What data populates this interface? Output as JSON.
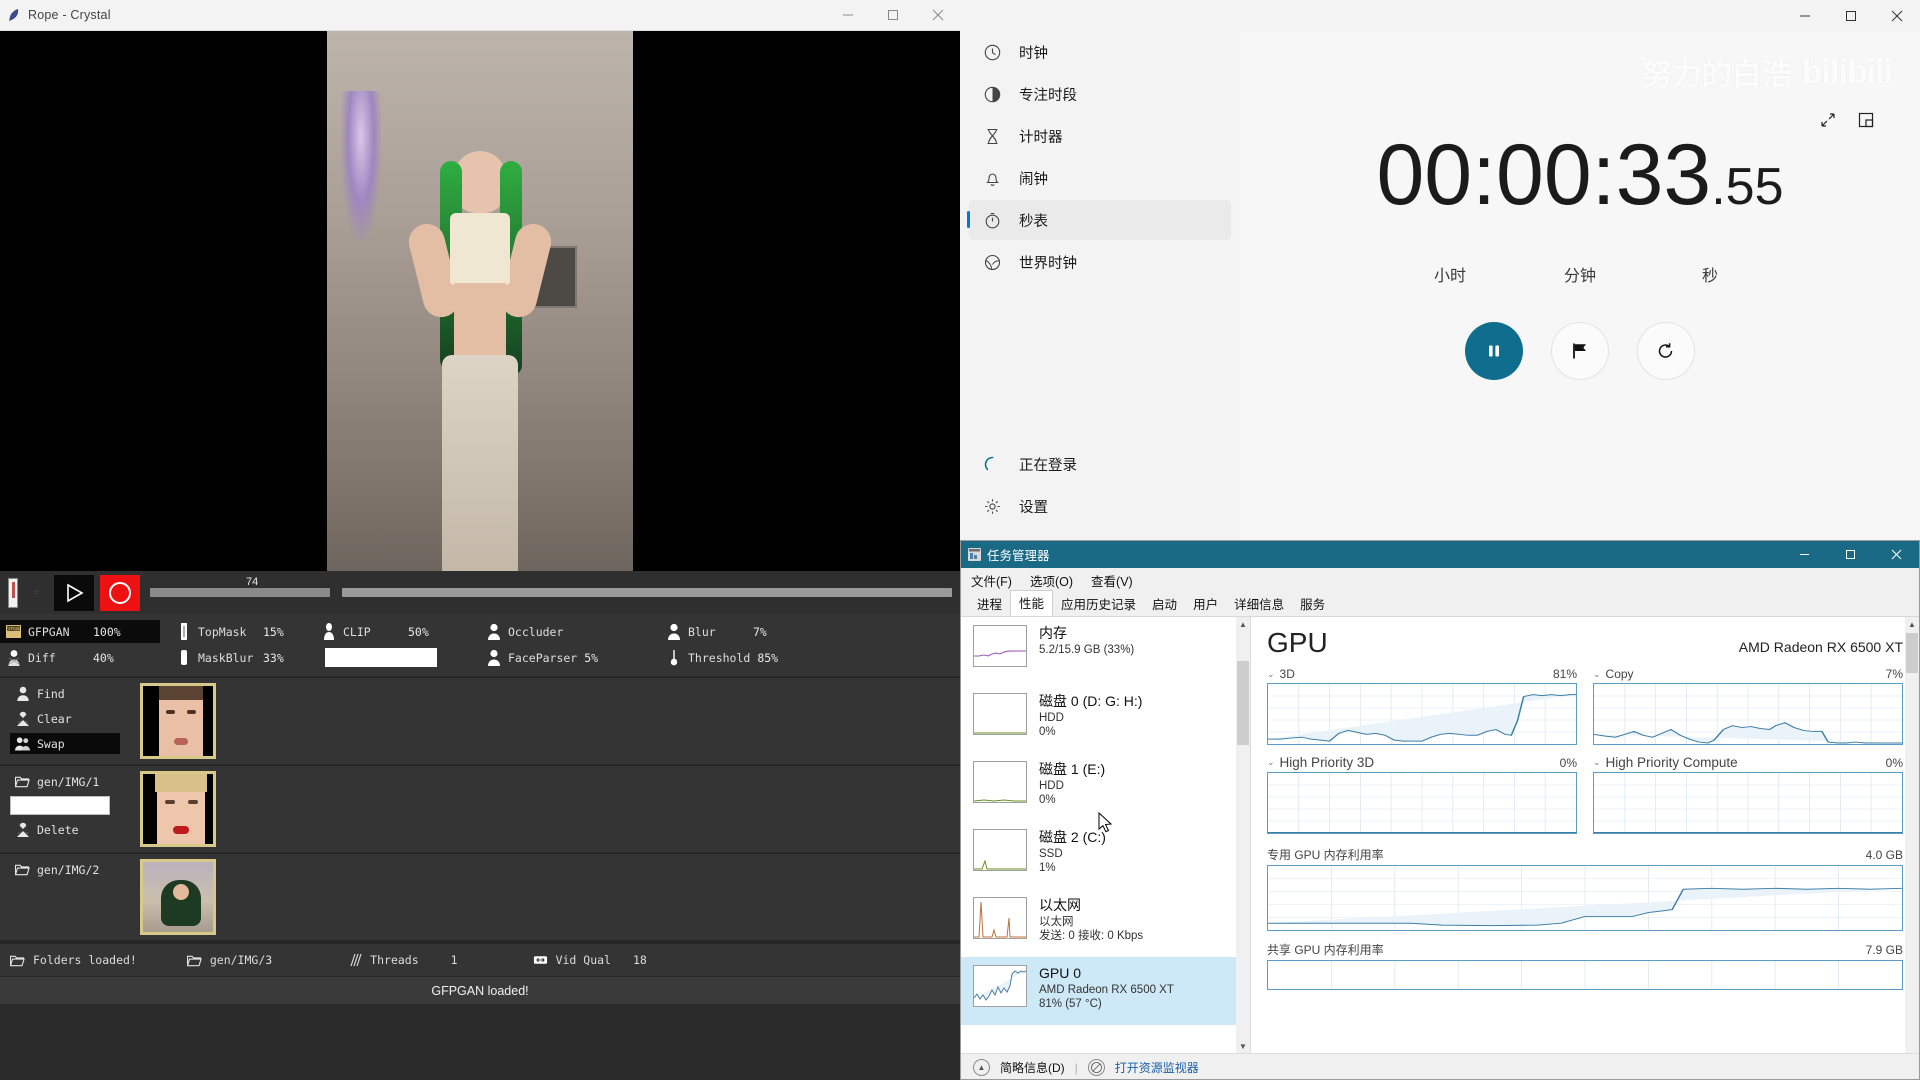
{
  "rope": {
    "titlebar": {
      "icon": "feather-icon",
      "title": "Rope - Crystal",
      "minimize": "—",
      "maximize": "□",
      "close": "✕"
    },
    "transport": {
      "play_label": "play-triangle",
      "record_label": "record-circle",
      "frame_number": "74"
    },
    "parameters": [
      {
        "icon": "gfpgan-icon",
        "label": "GFPGAN",
        "value": "100%",
        "active": true
      },
      {
        "icon": "topmask-icon",
        "label": "TopMask",
        "value": "15%",
        "active": false
      },
      {
        "icon": "clip-icon",
        "label": "CLIP",
        "value": "50%",
        "active": false
      },
      {
        "icon": "occluder-icon",
        "label": "Occluder",
        "value": "",
        "active": false
      },
      {
        "icon": "blur-icon",
        "label": "Blur",
        "value": "7%",
        "active": false
      },
      {
        "icon": "diff-icon",
        "label": "Diff",
        "value": "40%",
        "active": false
      },
      {
        "icon": "maskblur-icon",
        "label": "MaskBlur",
        "value": "33%",
        "active": false
      },
      {
        "icon": "text-input",
        "label": "",
        "value": "",
        "active": false
      },
      {
        "icon": "faceparser-icon",
        "label": "FaceParser",
        "value": "5%",
        "active": false
      },
      {
        "icon": "threshold-icon",
        "label": "Threshold",
        "value": "85%",
        "active": false
      }
    ],
    "face_panel": {
      "row1_buttons": [
        {
          "icon": "person-icon",
          "label": "Find",
          "selected": false
        },
        {
          "icon": "clearface-icon",
          "label": "Clear",
          "selected": false
        },
        {
          "icon": "swap-icon",
          "label": "Swap",
          "selected": true
        }
      ],
      "row2": {
        "folder_label": "gen/IMG/1",
        "input_value": "",
        "delete_label": "Delete"
      },
      "row3": {
        "folder_label": "gen/IMG/2"
      }
    },
    "statusbar": [
      {
        "icon": "folder-icon",
        "label": "Folders loaded!",
        "value": ""
      },
      {
        "icon": "folder-icon",
        "label": "gen/IMG/3",
        "value": ""
      },
      {
        "icon": "threads-icon",
        "label": "Threads",
        "value": "1"
      },
      {
        "icon": "vidqual-icon",
        "label": "Vid Qual",
        "value": "18"
      }
    ],
    "message": "GFPGAN loaded!"
  },
  "clock": {
    "window_controls": {
      "minimize": "—",
      "maximize": "□",
      "close": "✕"
    },
    "nav_items": [
      {
        "icon": "clock-icon",
        "label": "时钟",
        "active": false
      },
      {
        "icon": "focus-icon",
        "label": "专注时段",
        "active": false
      },
      {
        "icon": "timer-icon",
        "label": "计时器",
        "active": false
      },
      {
        "icon": "alarm-icon",
        "label": "闹钟",
        "active": false
      },
      {
        "icon": "stopwatch-icon",
        "label": "秒表",
        "active": true
      },
      {
        "icon": "worldclock-icon",
        "label": "世界时钟",
        "active": false
      }
    ],
    "footer_items": [
      {
        "icon": "spinner-icon",
        "label": "正在登录"
      },
      {
        "icon": "gear-icon",
        "label": "设置"
      }
    ],
    "watermark": {
      "text": "努力的白浩",
      "brand": "bilibili"
    },
    "main_actions": [
      {
        "icon": "expand-icon"
      },
      {
        "icon": "compact-icon"
      }
    ],
    "stopwatch": {
      "time": "00:00:33",
      "fraction": ".55",
      "unit_labels": [
        "小时",
        "分钟",
        "秒"
      ],
      "buttons": [
        {
          "icon": "pause-icon",
          "style": "primary"
        },
        {
          "icon": "flag-icon",
          "style": "ghost"
        },
        {
          "icon": "reset-icon",
          "style": "ghost"
        }
      ]
    }
  },
  "taskmgr": {
    "titlebar": {
      "icon": "taskmgr-icon",
      "title": "任务管理器",
      "minimize": "—",
      "maximize": "❐",
      "close": "✕"
    },
    "menu": [
      "文件(F)",
      "选项(O)",
      "查看(V)"
    ],
    "tabs": [
      {
        "label": "进程",
        "active": false
      },
      {
        "label": "性能",
        "active": true
      },
      {
        "label": "应用历史记录",
        "active": false
      },
      {
        "label": "启动",
        "active": false
      },
      {
        "label": "用户",
        "active": false
      },
      {
        "label": "详细信息",
        "active": false
      },
      {
        "label": "服务",
        "active": false
      }
    ],
    "resources": [
      {
        "name": "内存",
        "line2": "5.2/15.9 GB (33%)",
        "line3": "",
        "color": "#9b59b6",
        "selected": false
      },
      {
        "name": "磁盘 0 (D: G: H:)",
        "line2": "HDD",
        "line3": "0%",
        "color": "#6b8e23",
        "selected": false
      },
      {
        "name": "磁盘 1 (E:)",
        "line2": "HDD",
        "line3": "0%",
        "color": "#6b8e23",
        "selected": false
      },
      {
        "name": "磁盘 2 (C:)",
        "line2": "SSD",
        "line3": "1%",
        "color": "#6b8e23",
        "selected": false
      },
      {
        "name": "以太网",
        "line2": "以太网",
        "line3": "发送: 0  接收: 0 Kbps",
        "color": "#c0703a",
        "selected": false
      },
      {
        "name": "GPU 0",
        "line2": "AMD Radeon RX 6500 XT",
        "line3": "81%  (57 °C)",
        "color": "#4a7ba0",
        "selected": true
      }
    ],
    "detail": {
      "title": "GPU",
      "subtitle": "AMD Radeon RX 6500 XT",
      "charts": [
        {
          "label": "3D",
          "value": "81%"
        },
        {
          "label": "Copy",
          "value": "7%"
        },
        {
          "label": "High Priority 3D",
          "value": "0%"
        },
        {
          "label": "High Priority Compute",
          "value": "0%"
        }
      ],
      "memory_charts": [
        {
          "label": "专用 GPU 内存利用率",
          "value": "4.0 GB"
        },
        {
          "label": "共享 GPU 内存利用率",
          "value": "7.9 GB"
        }
      ]
    },
    "footer": {
      "collapse_label": "简略信息(D)",
      "resource_monitor_label": "打开资源监视器"
    }
  },
  "chart_data": [
    {
      "type": "line",
      "title": "3D",
      "ylabel": "%",
      "ylim": [
        0,
        100
      ],
      "grid": true,
      "y": [
        8,
        8,
        9,
        10,
        8,
        7,
        6,
        5,
        16,
        22,
        18,
        16,
        17,
        14,
        6,
        5,
        5,
        5,
        5,
        12,
        16,
        18,
        16,
        15,
        14,
        14,
        19,
        24,
        16,
        14,
        34,
        75,
        80,
        78,
        81,
        79,
        80,
        81,
        80,
        81,
        81
      ]
    },
    {
      "type": "line",
      "title": "Copy",
      "ylabel": "%",
      "ylim": [
        0,
        100
      ],
      "grid": true,
      "y": [
        22,
        19,
        16,
        20,
        25,
        21,
        17,
        22,
        27,
        18,
        12,
        6,
        4,
        3,
        2,
        5,
        28,
        37,
        33,
        35,
        32,
        30,
        28,
        34,
        41,
        30,
        22,
        20,
        19,
        19,
        4,
        3,
        3,
        4,
        3,
        3,
        4,
        3,
        4,
        4,
        3
      ]
    },
    {
      "type": "line",
      "title": "High Priority 3D",
      "ylabel": "%",
      "ylim": [
        0,
        100
      ],
      "grid": true,
      "y": [
        0,
        0,
        0,
        0,
        0,
        0,
        0,
        0,
        0,
        0,
        0,
        0,
        0,
        0,
        0,
        0,
        0,
        0,
        0,
        0,
        0
      ]
    },
    {
      "type": "line",
      "title": "High Priority Compute",
      "ylabel": "%",
      "ylim": [
        0,
        100
      ],
      "grid": true,
      "y": [
        0,
        0,
        0,
        0,
        0,
        0,
        0,
        0,
        0,
        0,
        0,
        0,
        0,
        0,
        0,
        0,
        0,
        0,
        0,
        0,
        0
      ]
    },
    {
      "type": "area",
      "title": "专用 GPU 内存利用率",
      "ylabel": "GB",
      "ylim": [
        0,
        4.0
      ],
      "grid": true,
      "y": [
        0.4,
        0.4,
        0.4,
        0.4,
        0.4,
        0.4,
        0.4,
        0.4,
        0.4,
        0.3,
        0.3,
        0.3,
        0.3,
        0.3,
        0.3,
        0.3,
        0.4,
        0.9,
        0.9,
        0.9,
        0.9,
        0.9,
        1.1,
        1.2,
        1.2,
        2.4,
        2.5,
        2.4,
        2.5,
        2.4,
        2.5,
        2.4,
        2.5,
        2.4,
        2.5,
        2.4,
        2.5,
        2.4,
        2.5,
        2.5,
        2.5
      ]
    },
    {
      "type": "area",
      "title": "共享 GPU 内存利用率",
      "ylabel": "GB",
      "ylim": [
        0,
        7.9
      ],
      "grid": true,
      "y": [
        0,
        0,
        0,
        0,
        0,
        0,
        0,
        0,
        0,
        0,
        0,
        0,
        0,
        0,
        0,
        0,
        0,
        0,
        0,
        0,
        0
      ]
    },
    {
      "type": "area",
      "title": "内存",
      "ylabel": "GB",
      "ylim": [
        0,
        15.9
      ],
      "grid": false,
      "y": [
        4.8,
        4.8,
        4.9,
        4.8,
        4.9,
        5.0,
        4.9,
        5.0,
        5.1,
        5.2,
        5.2,
        5.2,
        5.2,
        5.2,
        5.2,
        5.2
      ]
    }
  ]
}
